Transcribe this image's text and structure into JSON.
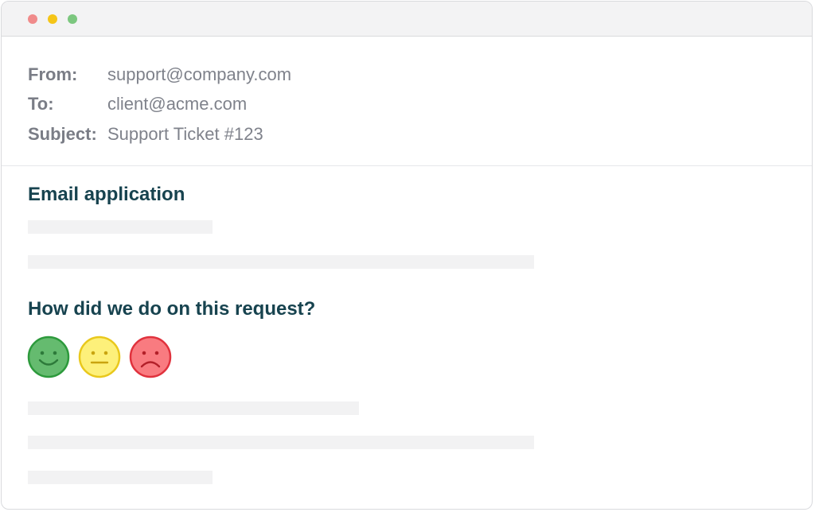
{
  "window": {
    "controls": {
      "close_color": "#f08b8b",
      "minimize_color": "#f5c518",
      "maximize_color": "#7cc77f"
    }
  },
  "email": {
    "from_label": "From:",
    "from_value": "support@company.com",
    "to_label": "To:",
    "to_value": "client@acme.com",
    "subject_label": "Subject:",
    "subject_value": "Support Ticket #123"
  },
  "body": {
    "title": "Email application",
    "question": "How did we do on this request?"
  },
  "ratings": [
    {
      "icon": "happy-face-icon",
      "color": "#65bb6f",
      "stroke": "#2d9a3c"
    },
    {
      "icon": "neutral-face-icon",
      "color": "#fdf07a",
      "stroke": "#e9c81c"
    },
    {
      "icon": "sad-face-icon",
      "color": "#f97b80",
      "stroke": "#e0323d"
    }
  ],
  "colors": {
    "heading": "#17434f",
    "header_text": "#7a7d86",
    "placeholder": "#f2f2f3"
  }
}
